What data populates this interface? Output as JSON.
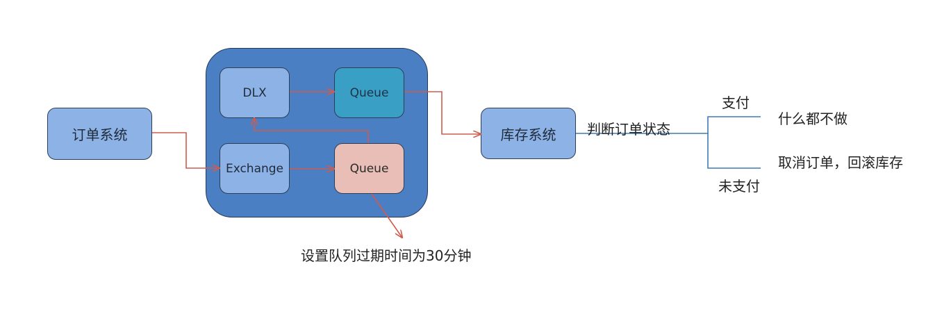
{
  "order_system": "订单系统",
  "dlx": "DLX",
  "exchange": "Exchange",
  "queue_top": "Queue",
  "queue_bottom": "Queue",
  "inventory_system": "库存系统",
  "judge_label": "判断订单状态",
  "paid_label": "支付",
  "unpaid_label": "未支付",
  "paid_action": "什么都不做",
  "unpaid_action": "取消订单，回滚库存",
  "ttl_note": "设置队列过期时间为30分钟",
  "colors": {
    "container": "#4a7fc3",
    "box_light_blue": "#8db2e6",
    "queue_teal": "#3a9fc4",
    "queue_pink": "#e9beb6",
    "arrow_red": "#cf5b4e",
    "branch_blue": "#3f78b8"
  }
}
